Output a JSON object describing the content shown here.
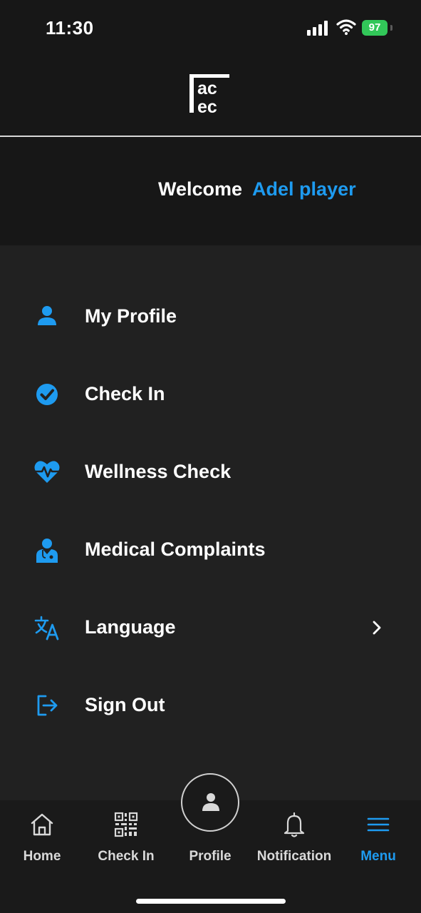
{
  "status_bar": {
    "time": "11:30",
    "battery": "97"
  },
  "header": {
    "logo_icon": "acec-logo-icon"
  },
  "welcome": {
    "label": "Welcome",
    "name": "Adel player"
  },
  "menu": {
    "items": [
      {
        "label": "My Profile",
        "icon": "person-icon"
      },
      {
        "label": "Check In",
        "icon": "check-circle-icon"
      },
      {
        "label": "Wellness Check",
        "icon": "heart-pulse-icon"
      },
      {
        "label": "Medical Complaints",
        "icon": "doctor-icon"
      },
      {
        "label": "Language",
        "icon": "translate-icon",
        "chevron": "chevron-right-icon"
      },
      {
        "label": "Sign Out",
        "icon": "sign-out-icon"
      }
    ]
  },
  "tab_bar": {
    "tabs": [
      {
        "label": "Home",
        "icon": "home-icon"
      },
      {
        "label": "Check In",
        "icon": "qr-code-icon"
      },
      {
        "label": "Profile",
        "icon": "person-icon"
      },
      {
        "label": "Notification",
        "icon": "bell-icon"
      },
      {
        "label": "Menu",
        "icon": "hamburger-icon",
        "active": true
      }
    ]
  },
  "colors": {
    "accent": "#1e9bf0",
    "background": "#171717",
    "menu_background": "#212121",
    "battery": "#32c759"
  }
}
